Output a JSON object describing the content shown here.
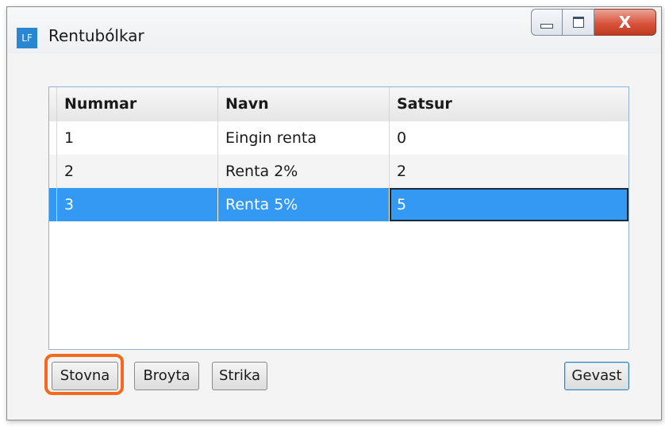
{
  "window": {
    "app_icon_text": "LF",
    "title": "Rentubólkar",
    "close_glyph": "X"
  },
  "grid": {
    "columns": [
      "Nummar",
      "Navn",
      "Satsur"
    ],
    "rows": [
      {
        "nummar": "1",
        "navn": "Eingin renta",
        "satsur": "0"
      },
      {
        "nummar": "2",
        "navn": "Renta 2%",
        "satsur": "2"
      },
      {
        "nummar": "3",
        "navn": "Renta 5%",
        "satsur": "5"
      }
    ],
    "selected_row": "3"
  },
  "buttons": {
    "stovna": "Stovna",
    "broyta": "Broyta",
    "strika": "Strika",
    "gevast": "Gevast"
  },
  "colors": {
    "selection": "#3399f3",
    "highlight": "#f36a1e",
    "app_icon": "#2b86d2"
  },
  "icons": [
    "minimize-icon",
    "maximize-icon",
    "close-icon",
    "app-icon"
  ]
}
